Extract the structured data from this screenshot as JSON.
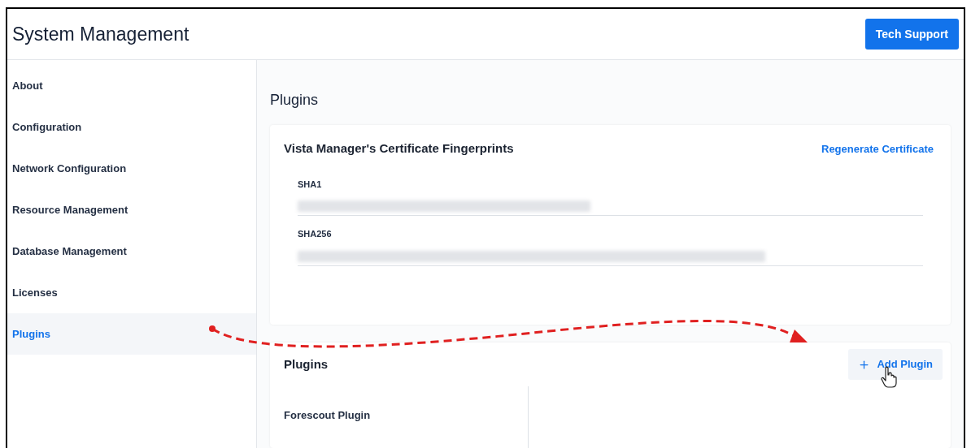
{
  "window": {
    "title": "System Management"
  },
  "header_button": "Tech Support",
  "sidebar": {
    "items": [
      {
        "label": "About",
        "selected": false
      },
      {
        "label": "Configuration",
        "selected": false
      },
      {
        "label": "Network Configuration",
        "selected": false
      },
      {
        "label": "Resource Management",
        "selected": false
      },
      {
        "label": "Database Management",
        "selected": false
      },
      {
        "label": "Licenses",
        "selected": false
      },
      {
        "label": "Plugins",
        "selected": true
      }
    ]
  },
  "page_title": "Plugins",
  "certificate_card": {
    "title": "Vista Manager's Certificate Fingerprints",
    "action": "Regenerate Certificate",
    "fields": [
      {
        "label": "SHA1"
      },
      {
        "label": "SHA256"
      }
    ]
  },
  "plugins_card": {
    "title": "Plugins",
    "add_button": "Add Plugin",
    "items": [
      {
        "name": "Forescout Plugin"
      }
    ]
  }
}
